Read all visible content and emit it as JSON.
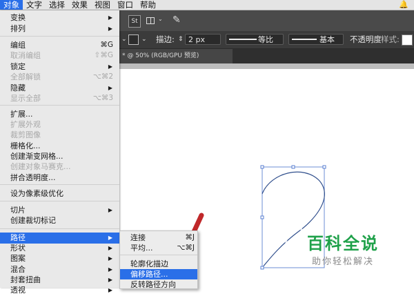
{
  "menubar": {
    "items": [
      "对象",
      "文字",
      "选择",
      "效果",
      "视图",
      "窗口",
      "帮助"
    ],
    "active_index": 0
  },
  "toolbar": {
    "stock_label": "St"
  },
  "controlbar": {
    "stroke_label": "描边:",
    "stroke_value": "2 px",
    "profile_label": "等比",
    "brush_label": "基本",
    "opacity_label": "不透明度",
    "style_label": "样式:"
  },
  "document": {
    "tab_label": "* @ 50% (RGB/GPU 预览)"
  },
  "object_menu": {
    "items": [
      {
        "label": "变换",
        "shortcut": "",
        "submenu": true,
        "disabled": false
      },
      {
        "label": "排列",
        "shortcut": "",
        "submenu": true,
        "disabled": false
      },
      {
        "label": "编组",
        "shortcut": "⌘G",
        "submenu": false,
        "disabled": false
      },
      {
        "label": "取消编组",
        "shortcut": "⇧⌘G",
        "submenu": false,
        "disabled": true
      },
      {
        "label": "锁定",
        "shortcut": "",
        "submenu": true,
        "disabled": false
      },
      {
        "label": "全部解锁",
        "shortcut": "⌥⌘2",
        "submenu": false,
        "disabled": true
      },
      {
        "label": "隐藏",
        "shortcut": "",
        "submenu": true,
        "disabled": false
      },
      {
        "label": "显示全部",
        "shortcut": "⌥⌘3",
        "submenu": false,
        "disabled": true
      },
      {
        "label": "扩展...",
        "shortcut": "",
        "submenu": false,
        "disabled": false
      },
      {
        "label": "扩展外观",
        "shortcut": "",
        "submenu": false,
        "disabled": true
      },
      {
        "label": "裁剪图像",
        "shortcut": "",
        "submenu": false,
        "disabled": true
      },
      {
        "label": "栅格化...",
        "shortcut": "",
        "submenu": false,
        "disabled": false
      },
      {
        "label": "创建渐变网格...",
        "shortcut": "",
        "submenu": false,
        "disabled": false
      },
      {
        "label": "创建对象马赛克...",
        "shortcut": "",
        "submenu": false,
        "disabled": true
      },
      {
        "label": "拼合透明度...",
        "shortcut": "",
        "submenu": false,
        "disabled": false
      },
      {
        "label": "设为像素级优化",
        "shortcut": "",
        "submenu": false,
        "disabled": false
      },
      {
        "label": "切片",
        "shortcut": "",
        "submenu": true,
        "disabled": false
      },
      {
        "label": "创建裁切标记",
        "shortcut": "",
        "submenu": false,
        "disabled": false
      },
      {
        "label": "路径",
        "shortcut": "",
        "submenu": true,
        "disabled": false,
        "highlighted": true
      },
      {
        "label": "形状",
        "shortcut": "",
        "submenu": true,
        "disabled": false
      },
      {
        "label": "图案",
        "shortcut": "",
        "submenu": true,
        "disabled": false
      },
      {
        "label": "混合",
        "shortcut": "",
        "submenu": true,
        "disabled": false
      },
      {
        "label": "封套扭曲",
        "shortcut": "",
        "submenu": true,
        "disabled": false
      },
      {
        "label": "透视",
        "shortcut": "",
        "submenu": true,
        "disabled": false
      }
    ]
  },
  "path_submenu": {
    "items": [
      {
        "label": "连接",
        "shortcut": "⌘J"
      },
      {
        "label": "平均...",
        "shortcut": "⌥⌘J"
      },
      {
        "label": "轮廓化描边",
        "shortcut": ""
      },
      {
        "label": "偏移路径...",
        "shortcut": "",
        "highlighted": true
      },
      {
        "label": "反转路径方向",
        "shortcut": ""
      }
    ]
  },
  "watermark": {
    "title": "百科全说",
    "subtitle": "助你轻松解决"
  },
  "colors": {
    "highlight": "#2a6fe8",
    "watermark_green": "#1fa14a",
    "annotation_arrow": "#c0282a",
    "path_stroke": "#2f4e8c"
  }
}
